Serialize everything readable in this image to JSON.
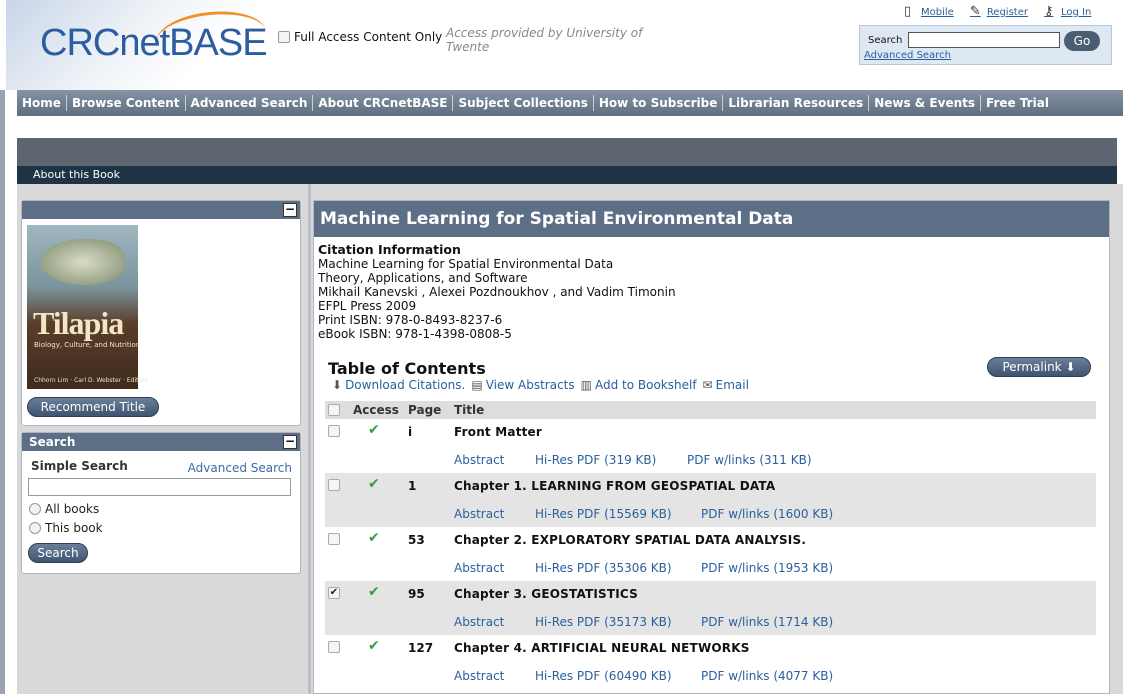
{
  "header": {
    "logo_text": "CRCnetBASE",
    "full_access_label": "Full Access Content Only",
    "access_note": "Access provided by University of Twente",
    "top_links": [
      "Mobile",
      "Register",
      "Log In"
    ],
    "search": {
      "label": "Search",
      "go": "Go",
      "advanced": "Advanced Search"
    }
  },
  "nav": [
    "Home",
    "Browse Content",
    "Advanced Search",
    "About CRCnetBASE",
    "Subject Collections",
    "How to Subscribe",
    "Librarian Resources",
    "News & Events",
    "Free Trial"
  ],
  "about_bar": "About this Book",
  "cover": {
    "title": "Tilapia",
    "subtitle": "Biology, Culture, and Nutrition",
    "editors": "Chhorn Lim · Carl D. Webster · Editors"
  },
  "recommend_button": "Recommend Title",
  "side_search": {
    "title": "Search",
    "simple": "Simple Search",
    "advanced": "Advanced Search",
    "options": [
      "All books",
      "This book"
    ],
    "button": "Search"
  },
  "book": {
    "title": "Machine Learning for Spatial Environmental Data",
    "citation_heading": "Citation Information",
    "citation_lines": [
      "Machine Learning for Spatial Environmental Data",
      "Theory, Applications, and Software",
      "Mikhail Kanevski , Alexei Pozdnoukhov , and Vadim Timonin",
      "EFPL Press 2009",
      "Print ISBN: 978-0-8493-8237-6",
      "eBook ISBN: 978-1-4398-0808-5"
    ]
  },
  "toc": {
    "title": "Table of Contents",
    "permalink": "Permalink",
    "actions": [
      "Download Citations.",
      "View Abstracts",
      "Add to Bookshelf",
      "Email"
    ],
    "headers": [
      "Access",
      "Page",
      "Title"
    ],
    "rows": [
      {
        "page": "i",
        "title": "Front Matter",
        "abstract": "Abstract",
        "hires": "Hi-Res PDF (319 KB)",
        "pdf": "PDF w/links (311 KB)",
        "checked": false
      },
      {
        "page": "1",
        "title": "Chapter 1. LEARNING FROM GEOSPATIAL DATA",
        "abstract": "Abstract",
        "hires": "Hi-Res PDF (15569 KB)",
        "pdf": "PDF w/links (1600 KB)",
        "checked": false
      },
      {
        "page": "53",
        "title": "Chapter 2. EXPLORATORY SPATIAL DATA ANALYSIS.",
        "abstract": "Abstract",
        "hires": "Hi-Res PDF (35306 KB)",
        "pdf": "PDF w/links (1953 KB)",
        "checked": false
      },
      {
        "page": "95",
        "title": "Chapter 3. GEOSTATISTICS",
        "abstract": "Abstract",
        "hires": "Hi-Res PDF (35173 KB)",
        "pdf": "PDF w/links (1714 KB)",
        "checked": true
      },
      {
        "page": "127",
        "title": "Chapter 4. ARTIFICIAL NEURAL NETWORKS",
        "abstract": "Abstract",
        "hires": "Hi-Res PDF (60490 KB)",
        "pdf": "PDF w/links (4077 KB)",
        "checked": false
      }
    ]
  },
  "colors": {
    "accent": "#5d6f86",
    "link": "#2a5f9e",
    "check": "#3a9a3a"
  }
}
